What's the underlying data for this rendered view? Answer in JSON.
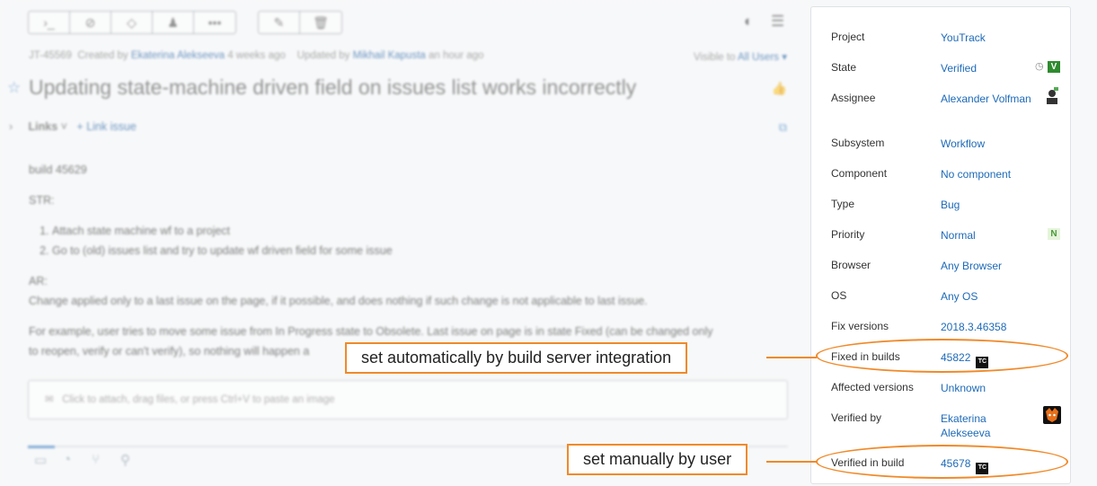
{
  "toolbar": {
    "group1": [
      "›_",
      "⊘",
      "◇",
      "♟",
      "•••"
    ],
    "group2": [
      "✎",
      "🗑"
    ]
  },
  "meta": {
    "issue_id": "JT-45569",
    "created_prefix": "Created by",
    "created_by": "Ekaterina Alekseeva",
    "created_ago": "4 weeks ago",
    "updated_prefix": "Updated by",
    "updated_by": "Mikhail Kapusta",
    "updated_ago": "an hour ago",
    "visible_prefix": "Visible to",
    "visible_to": "All Users ▾"
  },
  "issue": {
    "summary": "Updating state-machine driven field on issues list works incorrectly",
    "links_label": "Links",
    "link_issue": "Link issue",
    "description": {
      "build": "build 45629",
      "str": "STR:",
      "steps": [
        "Attach state machine wf to a project",
        "Go to (old) issues list and try to update wf driven field for some issue"
      ],
      "ar": "AR:",
      "ar_text": "Change applied only to a last issue on the page, if it possible, and does nothing if such change is not applicable to last issue.",
      "example_1": "For example, user tries to move some issue from In Progress state to Obsolete. Last issue on page is in state Fixed (can be changed only",
      "example_2": "to reopen, verify or can't verify), so nothing will happen a"
    },
    "comment_placeholder": "Click to attach, drag files, or press Ctrl+V to paste an image"
  },
  "fields": [
    {
      "label": "Project",
      "value": "YouTrack"
    },
    {
      "label": "State",
      "value": "Verified",
      "badge": "V"
    },
    {
      "label": "Assignee",
      "value": "Alexander Volfman"
    },
    {
      "label": "Subsystem",
      "value": "Workflow"
    },
    {
      "label": "Component",
      "value": "No component"
    },
    {
      "label": "Type",
      "value": "Bug"
    },
    {
      "label": "Priority",
      "value": "Normal",
      "badge": "N"
    },
    {
      "label": "Browser",
      "value": "Any Browser"
    },
    {
      "label": "OS",
      "value": "Any OS"
    },
    {
      "label": "Fix versions",
      "value": "2018.3.46358"
    },
    {
      "label": "Fixed in builds",
      "value": "45822",
      "badge": "TC"
    },
    {
      "label": "Affected versions",
      "value": "Unknown"
    },
    {
      "label": "Verified by",
      "value": "Ekaterina Alekseeva"
    },
    {
      "label": "Verified in build",
      "value": "45678",
      "badge": "TC"
    }
  ],
  "callouts": {
    "automatic": "set automatically by build server integration",
    "manual": "set manually by user"
  },
  "colors": {
    "accent_orange": "#f08a2a",
    "link_blue": "#1d6ab8",
    "verified_green": "#2e8b2e"
  }
}
